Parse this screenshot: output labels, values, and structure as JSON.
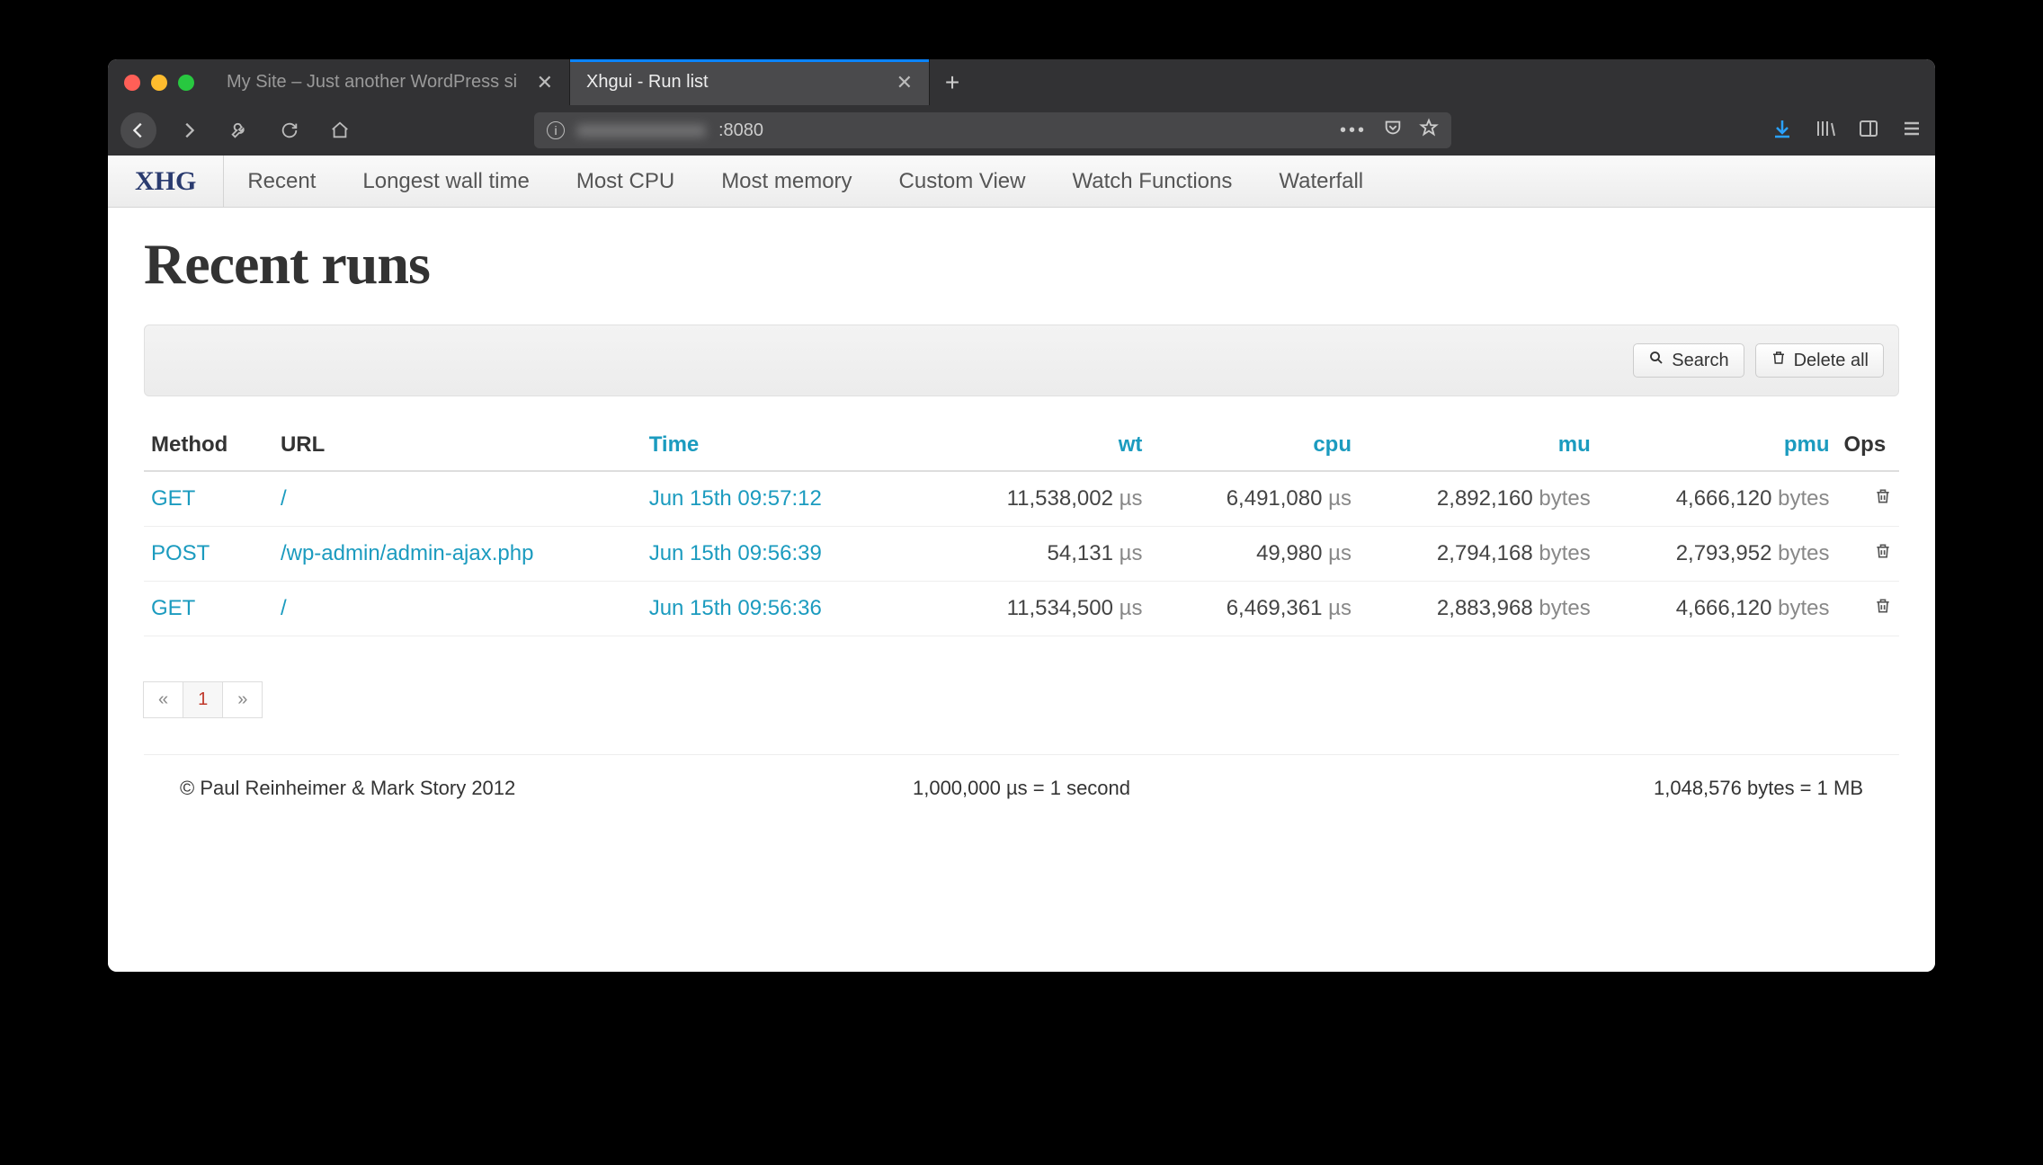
{
  "browser": {
    "tabs": [
      {
        "title": "My Site – Just another WordPress si",
        "active": false
      },
      {
        "title": "Xhgui - Run list",
        "active": true
      }
    ],
    "url_hidden": "xxxxxxxxxxxxx",
    "url_visible": ":8080"
  },
  "nav": {
    "brand": "XHG",
    "links": [
      "Recent",
      "Longest wall time",
      "Most CPU",
      "Most memory",
      "Custom View",
      "Watch Functions",
      "Waterfall"
    ]
  },
  "page": {
    "title": "Recent runs",
    "search_label": "Search",
    "delete_all_label": "Delete all"
  },
  "table": {
    "headers": {
      "method": "Method",
      "url": "URL",
      "time": "Time",
      "wt": "wt",
      "cpu": "cpu",
      "mu": "mu",
      "pmu": "pmu",
      "ops": "Ops"
    },
    "unit_time": "µs",
    "unit_bytes": "bytes",
    "rows": [
      {
        "method": "GET",
        "url": "/",
        "time": "Jun 15th 09:57:12",
        "wt": "11,538,002",
        "cpu": "6,491,080",
        "mu": "2,892,160",
        "pmu": "4,666,120"
      },
      {
        "method": "POST",
        "url": "/wp-admin/admin-ajax.php",
        "time": "Jun 15th 09:56:39",
        "wt": "54,131",
        "cpu": "49,980",
        "mu": "2,794,168",
        "pmu": "2,793,952"
      },
      {
        "method": "GET",
        "url": "/",
        "time": "Jun 15th 09:56:36",
        "wt": "11,534,500",
        "cpu": "6,469,361",
        "mu": "2,883,968",
        "pmu": "4,666,120"
      }
    ]
  },
  "pager": {
    "prev": "«",
    "current": "1",
    "next": "»"
  },
  "footer": {
    "left": "© Paul Reinheimer & Mark Story 2012",
    "center": "1,000,000 µs = 1 second",
    "right": "1,048,576 bytes = 1 MB"
  }
}
